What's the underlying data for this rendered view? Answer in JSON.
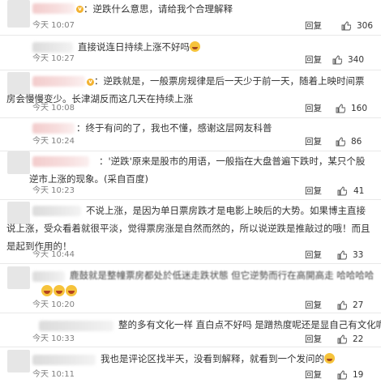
{
  "comments": [
    {
      "text": "：逆跌什么意思，请给我个合理解释",
      "time": "今天 10:07",
      "reply": "回复",
      "likes": "306"
    },
    {
      "text": "直接说连日持续上涨不好吗",
      "time": "今天 10:27",
      "reply": "回复",
      "likes": "340"
    },
    {
      "text": "：逆跌就是，一般票房规律是后一天少于前一天，随着上映时间票房会慢慢变少。长津湖反而这几天在持续上涨",
      "time": "今天 10:08",
      "reply": "回复",
      "likes": "160"
    },
    {
      "text": "：终于有问的了，我也不懂，感谢这层网友科普",
      "time": "今天 10:24",
      "reply": "回复",
      "likes": "86"
    },
    {
      "text": "：'逆跌'原来是股市的用语，一般指在大盘普遍下跌时，某只个股逆市上涨的现象。(采自百度)",
      "time": "今天 10:23",
      "reply": "回复",
      "likes": "41"
    },
    {
      "text": "不说上涨，是因为单日票房跌才是电影上映后的大势。如果博主直接说上涨，受众看着就很平淡，觉得票房涨是自然而然的，所以说逆跌是推敲过的哦！而且是起到作用的！",
      "time": "今天 10:44",
      "reply": "回复",
      "likes": "33"
    },
    {
      "text": "鹿鼓就是整幢票房都处於低迷走跌状態 但它逆勢而行在高開高走 哈哈哈哈",
      "time": "今天 10:20",
      "reply": "回复",
      "likes": "27"
    },
    {
      "text": "整的多有文化一样 直白点不好吗 是蹭热度呢还是显自己有文化呢",
      "time": "今天 10:33",
      "reply": "回复",
      "likes": "22"
    },
    {
      "text": "我也是评论区找半天，没看到解释，就看到一个发问的",
      "time": "今天 10:11",
      "reply": "回复",
      "likes": "19"
    }
  ],
  "colors": {
    "text": "#333333",
    "meta": "#808080",
    "divider": "#e9e9e9",
    "vip_badge": "#f3b230"
  },
  "icons": {
    "like": "thumbs-up-icon",
    "verified": "v-badge-icon",
    "emoji": "laughing-emoji-icon"
  }
}
